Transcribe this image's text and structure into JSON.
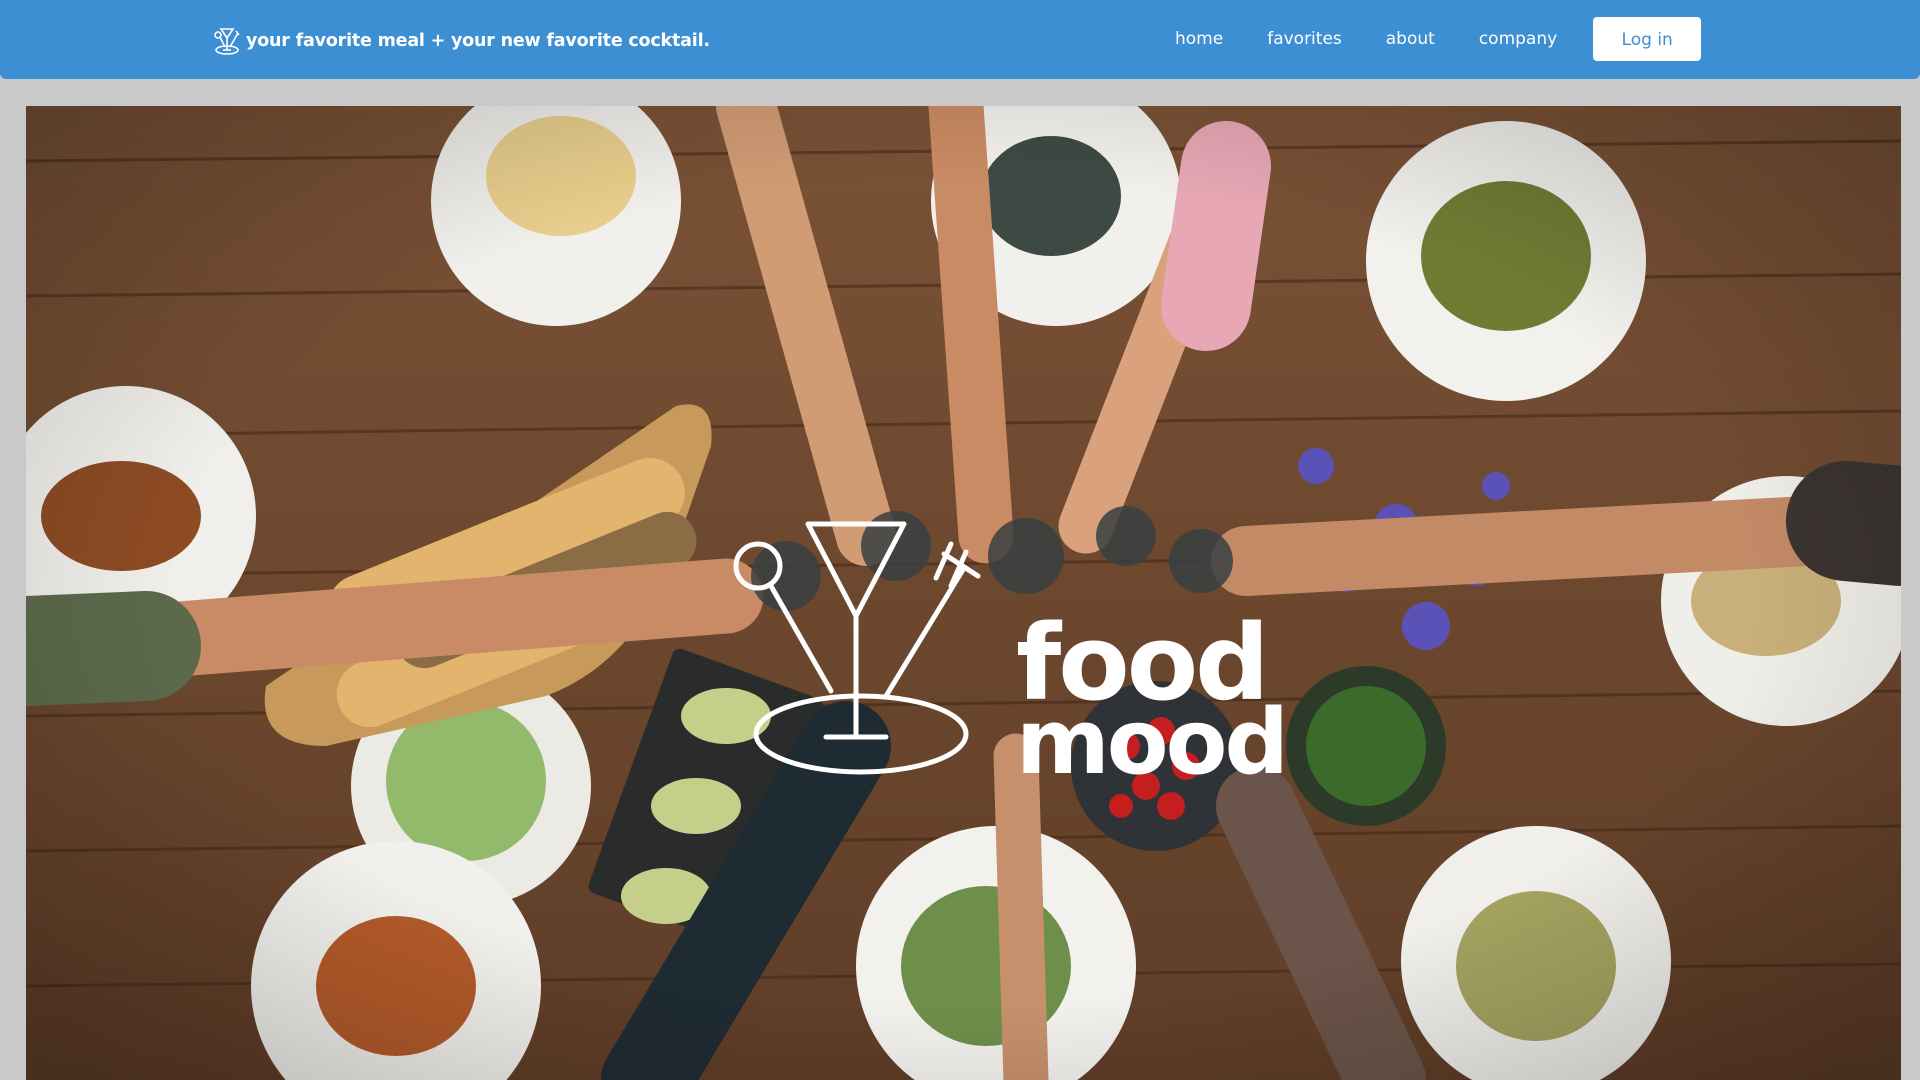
{
  "header": {
    "logo_icon": "martini-fork-spoon-icon",
    "tagline": "your favorite meal + your new favorite cocktail.",
    "nav": [
      {
        "label": "home"
      },
      {
        "label": "favorites"
      },
      {
        "label": "about"
      },
      {
        "label": "company"
      }
    ],
    "login_label": "Log in"
  },
  "hero": {
    "image": "overhead photo of people toasting drinks over a wooden table with pasta, salads, bread, avocados, tomatoes and flowers",
    "logo_line1": "food",
    "logo_line2": "mood"
  },
  "colors": {
    "header_bg": "#3d8fd4",
    "page_bg": "#c9c9c9",
    "button_text": "#3d8fd4"
  }
}
